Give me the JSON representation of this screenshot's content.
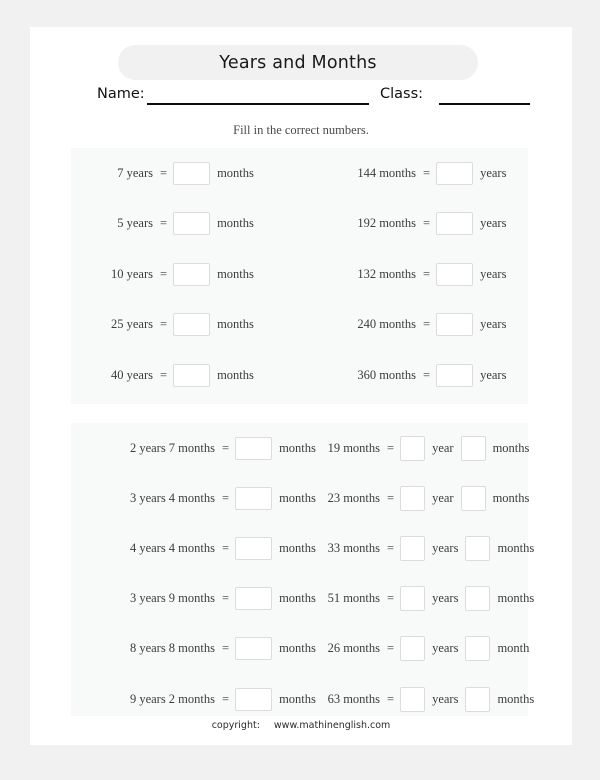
{
  "worksheet": {
    "title": "Years and Months",
    "instruction": "Fill in the correct numbers.",
    "name_label": "Name:",
    "class_label": "Class:",
    "name_value": "",
    "class_value": "",
    "footer": {
      "copyright_label": "copyright:",
      "site": "www.mathinenglish.com"
    }
  },
  "units": {
    "months": "months",
    "years": "years",
    "year": "year",
    "month": "month",
    "equals": "="
  },
  "section_basic": {
    "rows": [
      {
        "left": {
          "lead": "7 years",
          "answer": "",
          "unit": "months"
        },
        "right": {
          "lead": "144 months",
          "answer": "",
          "unit": "years"
        }
      },
      {
        "left": {
          "lead": "5 years",
          "answer": "",
          "unit": "months"
        },
        "right": {
          "lead": "192 months",
          "answer": "",
          "unit": "years"
        }
      },
      {
        "left": {
          "lead": "10 years",
          "answer": "",
          "unit": "months"
        },
        "right": {
          "lead": "132 months",
          "answer": "",
          "unit": "years"
        }
      },
      {
        "left": {
          "lead": "25 years",
          "answer": "",
          "unit": "months"
        },
        "right": {
          "lead": "240 months",
          "answer": "",
          "unit": "years"
        }
      },
      {
        "left": {
          "lead": "40 years",
          "answer": "",
          "unit": "months"
        },
        "right": {
          "lead": "360 months",
          "answer": "",
          "unit": "years"
        }
      }
    ]
  },
  "section_mixed": {
    "rows": [
      {
        "left": {
          "lead": "2 years 7 months",
          "answer": "",
          "unit": "months"
        },
        "right": {
          "lead": "19 months",
          "answer_years": "",
          "unit_years": "year",
          "answer_months": "",
          "unit_months": "months"
        }
      },
      {
        "left": {
          "lead": "3 years 4 months",
          "answer": "",
          "unit": "months"
        },
        "right": {
          "lead": "23 months",
          "answer_years": "",
          "unit_years": "year",
          "answer_months": "",
          "unit_months": "months"
        }
      },
      {
        "left": {
          "lead": "4 years 4 months",
          "answer": "",
          "unit": "months"
        },
        "right": {
          "lead": "33 months",
          "answer_years": "",
          "unit_years": "years",
          "answer_months": "",
          "unit_months": "months"
        }
      },
      {
        "left": {
          "lead": "3 years 9 months",
          "answer": "",
          "unit": "months"
        },
        "right": {
          "lead": "51 months",
          "answer_years": "",
          "unit_years": "years",
          "answer_months": "",
          "unit_months": "months"
        }
      },
      {
        "left": {
          "lead": "8 years 8 months",
          "answer": "",
          "unit": "months"
        },
        "right": {
          "lead": "26 months",
          "answer_years": "",
          "unit_years": "years",
          "answer_months": "",
          "unit_months": "month"
        }
      },
      {
        "left": {
          "lead": "9 years 2 months",
          "answer": "",
          "unit": "months"
        },
        "right": {
          "lead": "63 months",
          "answer_years": "",
          "unit_years": "years",
          "answer_months": "",
          "unit_months": "months"
        }
      }
    ]
  }
}
